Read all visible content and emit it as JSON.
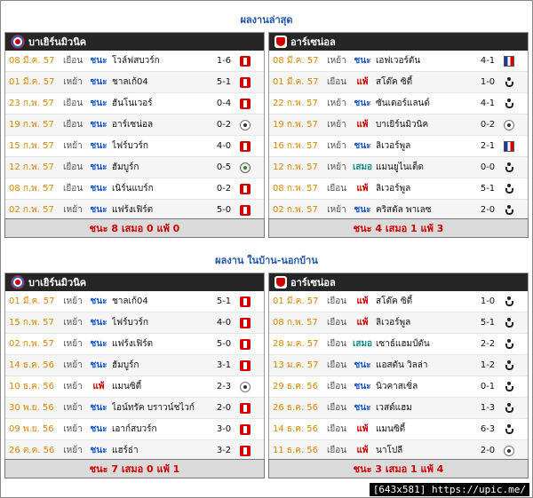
{
  "sections": [
    {
      "title": "ผลงานล่าสุด",
      "left": {
        "team": "บาเยิร์นมิวนิค",
        "crest": "bayern",
        "rows": [
          {
            "date": "08 มี.ค. 57",
            "venue": "เยือน",
            "result": "ชนะ",
            "opponent": "โวล์ฟสบวร์ก",
            "score": "1-6",
            "comp": "bundesliga-icon"
          },
          {
            "date": "01 มี.ค. 57",
            "venue": "เหย้า",
            "result": "ชนะ",
            "opponent": "ชาลเก้04",
            "score": "5-1",
            "comp": "bundesliga-icon"
          },
          {
            "date": "23 ก.พ. 57",
            "venue": "เยือน",
            "result": "ชนะ",
            "opponent": "ฮันโนเวอร์",
            "score": "0-4",
            "comp": "bundesliga-icon"
          },
          {
            "date": "19 ก.พ. 57",
            "venue": "เยือน",
            "result": "ชนะ",
            "opponent": "อาร์เซน่อล",
            "score": "0-2",
            "comp": "champions-league-icon"
          },
          {
            "date": "15 ก.พ. 57",
            "venue": "เหย้า",
            "result": "ชนะ",
            "opponent": "ไฟร์บวร์ก",
            "score": "4-0",
            "comp": "bundesliga-icon"
          },
          {
            "date": "12 ก.พ. 57",
            "venue": "เยือน",
            "result": "ชนะ",
            "opponent": "ฮัมบูร์ก",
            "score": "0-5",
            "comp": "dfb-pokal-icon"
          },
          {
            "date": "08 ก.พ. 57",
            "venue": "เยือน",
            "result": "ชนะ",
            "opponent": "เนิร์นแบร์ก",
            "score": "0-2",
            "comp": "bundesliga-icon"
          },
          {
            "date": "02 ก.พ. 57",
            "venue": "เหย้า",
            "result": "ชนะ",
            "opponent": "แฟร้งเฟิร์ต",
            "score": "5-0",
            "comp": "bundesliga-icon"
          }
        ],
        "summary": "ชนะ 8 เสมอ 0 แพ้ 0"
      },
      "right": {
        "team": "อาร์เซน่อล",
        "crest": "arsenal",
        "rows": [
          {
            "date": "08 มี.ค. 57",
            "venue": "เหย้า",
            "result": "ชนะ",
            "opponent": "เอฟเวอร์ตัน",
            "score": "4-1",
            "comp": "fa-cup-icon"
          },
          {
            "date": "01 มี.ค. 57",
            "venue": "เยือน",
            "result": "แพ้",
            "opponent": "สโต๊ค ซิตี้",
            "score": "1-0",
            "comp": "premier-league-icon"
          },
          {
            "date": "22 ก.พ. 57",
            "venue": "เหย้า",
            "result": "ชนะ",
            "opponent": "ซันเดอร์แลนด์",
            "score": "4-1",
            "comp": "premier-league-icon"
          },
          {
            "date": "19 ก.พ. 57",
            "venue": "เหย้า",
            "result": "แพ้",
            "opponent": "บาเยิร์นมิวนิค",
            "score": "0-2",
            "comp": "champions-league-icon"
          },
          {
            "date": "16 ก.พ. 57",
            "venue": "เหย้า",
            "result": "ชนะ",
            "opponent": "ลิเวอร์พูล",
            "score": "2-1",
            "comp": "fa-cup-icon"
          },
          {
            "date": "12 ก.พ. 57",
            "venue": "เหย้า",
            "result": "เสมอ",
            "opponent": "แมนยูไนเต็ด",
            "score": "0-0",
            "comp": "premier-league-icon"
          },
          {
            "date": "08 ก.พ. 57",
            "venue": "เยือน",
            "result": "แพ้",
            "opponent": "ลิเวอร์พูล",
            "score": "5-1",
            "comp": "premier-league-icon"
          },
          {
            "date": "02 ก.พ. 57",
            "venue": "เหย้า",
            "result": "ชนะ",
            "opponent": "คริสตัล พาเลซ",
            "score": "2-0",
            "comp": "premier-league-icon"
          }
        ],
        "summary": "ชนะ 4 เสมอ 1 แพ้ 3"
      }
    },
    {
      "title": "ผลงาน ในบ้าน-นอกบ้าน",
      "left": {
        "team": "บาเยิร์นมิวนิค",
        "crest": "bayern",
        "rows": [
          {
            "date": "01 มี.ค. 57",
            "venue": "เหย้า",
            "result": "ชนะ",
            "opponent": "ชาลเก้04",
            "score": "5-1",
            "comp": "bundesliga-icon"
          },
          {
            "date": "15 ก.พ. 57",
            "venue": "เหย้า",
            "result": "ชนะ",
            "opponent": "ไฟร์บวร์ก",
            "score": "4-0",
            "comp": "bundesliga-icon"
          },
          {
            "date": "02 ก.พ. 57",
            "venue": "เหย้า",
            "result": "ชนะ",
            "opponent": "แฟร้งเฟิร์ต",
            "score": "5-0",
            "comp": "bundesliga-icon"
          },
          {
            "date": "14 ธ.ค. 56",
            "venue": "เหย้า",
            "result": "ชนะ",
            "opponent": "ฮัมบูร์ก",
            "score": "3-1",
            "comp": "bundesliga-icon"
          },
          {
            "date": "10 ธ.ค. 56",
            "venue": "เหย้า",
            "result": "แพ้",
            "opponent": "แมนซิตี้",
            "score": "2-3",
            "comp": "champions-league-icon"
          },
          {
            "date": "30 พ.ย. 56",
            "venue": "เหย้า",
            "result": "ชนะ",
            "opponent": "ไอน์ทรัค บราวน์ชไวก์",
            "score": "2-0",
            "comp": "bundesliga-icon"
          },
          {
            "date": "09 พ.ย. 56",
            "venue": "เหย้า",
            "result": "ชนะ",
            "opponent": "เอาก์สบวร์ก",
            "score": "3-0",
            "comp": "bundesliga-icon"
          },
          {
            "date": "26 ต.ค. 56",
            "venue": "เหย้า",
            "result": "ชนะ",
            "opponent": "แฮร์ธ่า",
            "score": "3-2",
            "comp": "bundesliga-icon"
          }
        ],
        "summary": "ชนะ 7 เสมอ 0 แพ้ 1"
      },
      "right": {
        "team": "อาร์เซน่อล",
        "crest": "arsenal",
        "rows": [
          {
            "date": "01 มี.ค. 57",
            "venue": "เยือน",
            "result": "แพ้",
            "opponent": "สโต๊ค ซิตี้",
            "score": "1-0",
            "comp": "premier-league-icon"
          },
          {
            "date": "08 ก.พ. 57",
            "venue": "เยือน",
            "result": "แพ้",
            "opponent": "ลิเวอร์พูล",
            "score": "5-1",
            "comp": "premier-league-icon"
          },
          {
            "date": "28 ม.ค. 57",
            "venue": "เยือน",
            "result": "เสมอ",
            "opponent": "เซาธ์แฮมป์ตัน",
            "score": "2-2",
            "comp": "premier-league-icon"
          },
          {
            "date": "13 ม.ค. 57",
            "venue": "เยือน",
            "result": "ชนะ",
            "opponent": "แอสตัน วิลล่า",
            "score": "1-2",
            "comp": "premier-league-icon"
          },
          {
            "date": "29 ธ.ค. 56",
            "venue": "เยือน",
            "result": "ชนะ",
            "opponent": "นิวคาสเซิ่ล",
            "score": "0-1",
            "comp": "premier-league-icon"
          },
          {
            "date": "26 ธ.ค. 56",
            "venue": "เยือน",
            "result": "ชนะ",
            "opponent": "เวสต์แฮม",
            "score": "1-3",
            "comp": "premier-league-icon"
          },
          {
            "date": "14 ธ.ค. 56",
            "venue": "เยือน",
            "result": "แพ้",
            "opponent": "แมนซิตี้",
            "score": "6-3",
            "comp": "premier-league-icon"
          },
          {
            "date": "11 ธ.ค. 56",
            "venue": "เยือน",
            "result": "แพ้",
            "opponent": "นาโปลี",
            "score": "2-0",
            "comp": "champions-league-icon"
          }
        ],
        "summary": "ชนะ 3 เสมอ 1 แพ้ 4"
      }
    }
  ],
  "watermark": "[643x581] https://upic.me/"
}
